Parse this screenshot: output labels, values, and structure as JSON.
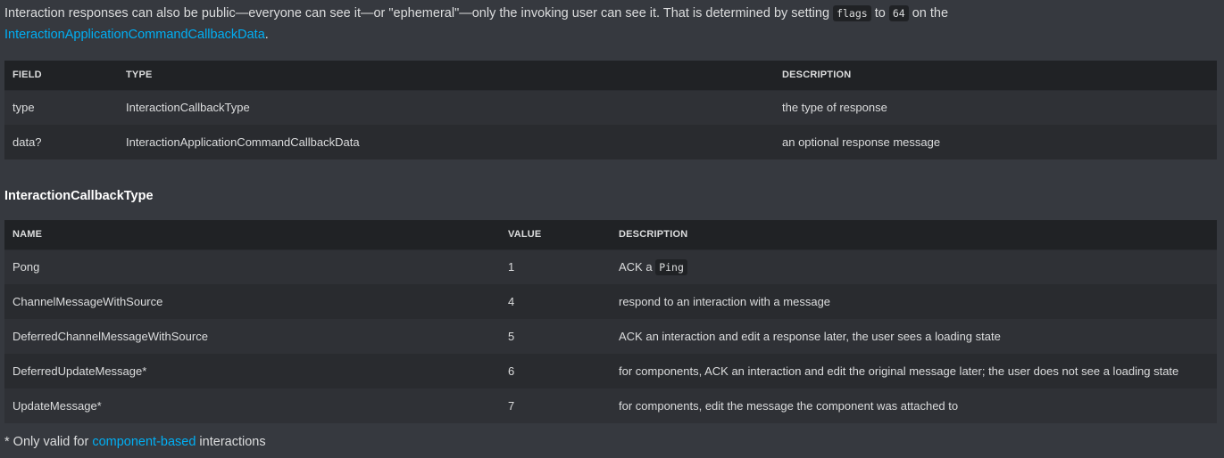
{
  "intro": {
    "part1": "Interaction responses can also be public—everyone can see it—or \"ephemeral\"—only the invoking user can see it. That is determined by setting ",
    "code1": "flags",
    "part2": " to ",
    "code2": "64",
    "part3": " on the ",
    "link": "InteractionApplicationCommandCallbackData",
    "part4": "."
  },
  "response_table": {
    "headers": [
      "FIELD",
      "TYPE",
      "DESCRIPTION"
    ],
    "rows": [
      [
        "type",
        "InteractionCallbackType",
        "the type of response"
      ],
      [
        "data?",
        "InteractionApplicationCommandCallbackData",
        "an optional response message"
      ]
    ]
  },
  "callback_type": {
    "title": "InteractionCallbackType",
    "headers": [
      "NAME",
      "VALUE",
      "DESCRIPTION"
    ],
    "rows": [
      {
        "name": "Pong",
        "value": "1",
        "desc_prefix": "ACK a ",
        "desc_code": "Ping",
        "desc": ""
      },
      {
        "name": "ChannelMessageWithSource",
        "value": "4",
        "desc": "respond to an interaction with a message"
      },
      {
        "name": "DeferredChannelMessageWithSource",
        "value": "5",
        "desc": "ACK an interaction and edit a response later, the user sees a loading state"
      },
      {
        "name": "DeferredUpdateMessage*",
        "value": "6",
        "desc": "for components, ACK an interaction and edit the original message later; the user does not see a loading state"
      },
      {
        "name": "UpdateMessage*",
        "value": "7",
        "desc": "for components, edit the message the component was attached to"
      }
    ]
  },
  "footnote": {
    "prefix": "* Only valid for ",
    "link": "component-based",
    "suffix": " interactions"
  },
  "colors": {
    "background": "#36393f",
    "link": "#00aff4",
    "header_bg": "#202225"
  }
}
